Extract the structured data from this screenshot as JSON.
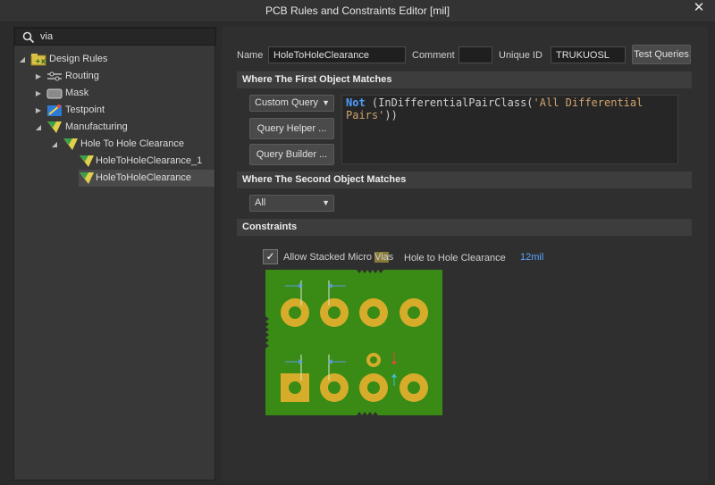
{
  "window": {
    "title": "PCB Rules and Constraints Editor [mil]",
    "close_glyph": "✕"
  },
  "search": {
    "value": "via",
    "icon": "search-icon"
  },
  "tree": {
    "root": {
      "label": "Design Rules",
      "icon": "design-rules-icon"
    },
    "items": [
      {
        "label": "Routing",
        "icon": "routing-icon"
      },
      {
        "label": "Mask",
        "icon": "mask-icon"
      },
      {
        "label": "Testpoint",
        "icon": "testpoint-icon"
      },
      {
        "label": "Manufacturing",
        "icon": "manufacturing-icon"
      }
    ],
    "category": {
      "label": "Hole To Hole Clearance",
      "icon": "rule-category-icon"
    },
    "rules": [
      {
        "label": "HoleToHoleClearance_1",
        "icon": "rule-icon"
      },
      {
        "label": "HoleToHoleClearance",
        "icon": "rule-icon",
        "selected": true
      }
    ]
  },
  "rule": {
    "name_label": "Name",
    "name_value": "HoleToHoleClearance",
    "comment_label": "Comment",
    "comment_value": "",
    "uid_label": "Unique ID",
    "uid_value": "TRUKUOSL",
    "test_button": "Test Queries"
  },
  "first_match": {
    "heading": "Where The First Object Matches",
    "dropdown": "Custom Query",
    "query_helper": "Query Helper ...",
    "query_builder": "Query Builder ...",
    "query_keyword": "Not",
    "query_text_pre": " (InDifferentialPairClass(",
    "query_string_a": "'All Differential",
    "query_string_b": "Pairs'",
    "query_text_post": "))"
  },
  "second_match": {
    "heading": "Where The Second Object Matches",
    "dropdown": "All"
  },
  "constraints": {
    "heading": "Constraints",
    "checkbox_checked": true,
    "checkbox_label_pre": "Allow Stacked Micro ",
    "checkbox_label_hl": "Via",
    "checkbox_label_post": "s",
    "clearance_label": "Hole to Hole Clearance",
    "clearance_value": "12mil"
  },
  "colors": {
    "board": "#3a8a16",
    "pad": "#d6ac2a",
    "hole": "#3a8a16",
    "query_keyword": "#4d9dff",
    "query_string": "#d0a36f",
    "clearance_value": "#5aa6ff"
  }
}
